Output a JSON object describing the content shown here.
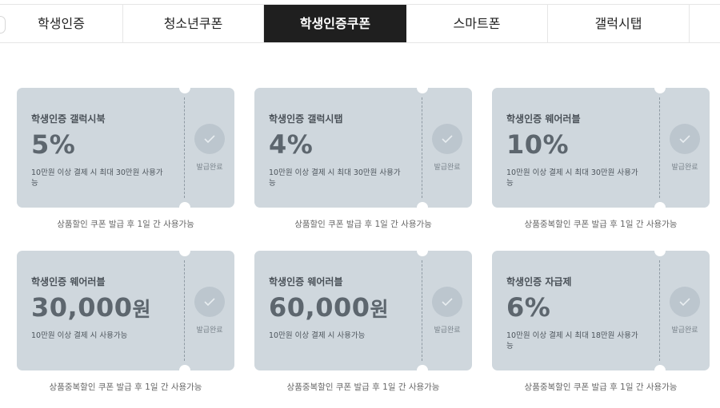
{
  "tabs": [
    {
      "label": "학생인증",
      "active": false
    },
    {
      "label": "청소년쿠폰",
      "active": false
    },
    {
      "label": "학생인증쿠폰",
      "active": true
    },
    {
      "label": "스마트폰",
      "active": false
    },
    {
      "label": "갤럭시탭",
      "active": false
    }
  ],
  "coupons": [
    {
      "title": "학생인증 갤럭시북",
      "value": "5%",
      "unit": "",
      "condition": "10만원 이상 결제 시 최대 30만원 사용가능",
      "status": "발급완료",
      "note": "상품할인 쿠폰 발급 후 1일 간 사용가능"
    },
    {
      "title": "학생인증 갤럭시탭",
      "value": "4%",
      "unit": "",
      "condition": "10만원 이상 결제 시 최대 30만원 사용가능",
      "status": "발급완료",
      "note": "상품할인 쿠폰 발급 후 1일 간 사용가능"
    },
    {
      "title": "학생인증 웨어러블",
      "value": "10%",
      "unit": "",
      "condition": "10만원 이상 결제 시 최대 30만원 사용가능",
      "status": "발급완료",
      "note": "상품중복할인 쿠폰 발급 후 1일 간 사용가능"
    },
    {
      "title": "학생인증 웨어러블",
      "value": "30,000",
      "unit": "원",
      "condition": "10만원 이상 결제 시 사용가능",
      "status": "발급완료",
      "note": "상품중복할인 쿠폰 발급 후 1일 간 사용가능"
    },
    {
      "title": "학생인증 웨어러블",
      "value": "60,000",
      "unit": "원",
      "condition": "10만원 이상 결제 시 사용가능",
      "status": "발급완료",
      "note": "상품중복할인 쿠폰 발급 후 1일 간 사용가능"
    },
    {
      "title": "학생인증 자급제",
      "value": "6%",
      "unit": "",
      "condition": "10만원 이상 결제 시 최대 18만원 사용가능",
      "status": "발급완료",
      "note": "상품중복할인 쿠폰 발급 후 1일 간 사용가능"
    }
  ],
  "colors": {
    "coupon_bg": "#cfd7dd",
    "active_tab_bg": "#1f1f1f"
  },
  "icons": {
    "status": "check-icon"
  }
}
